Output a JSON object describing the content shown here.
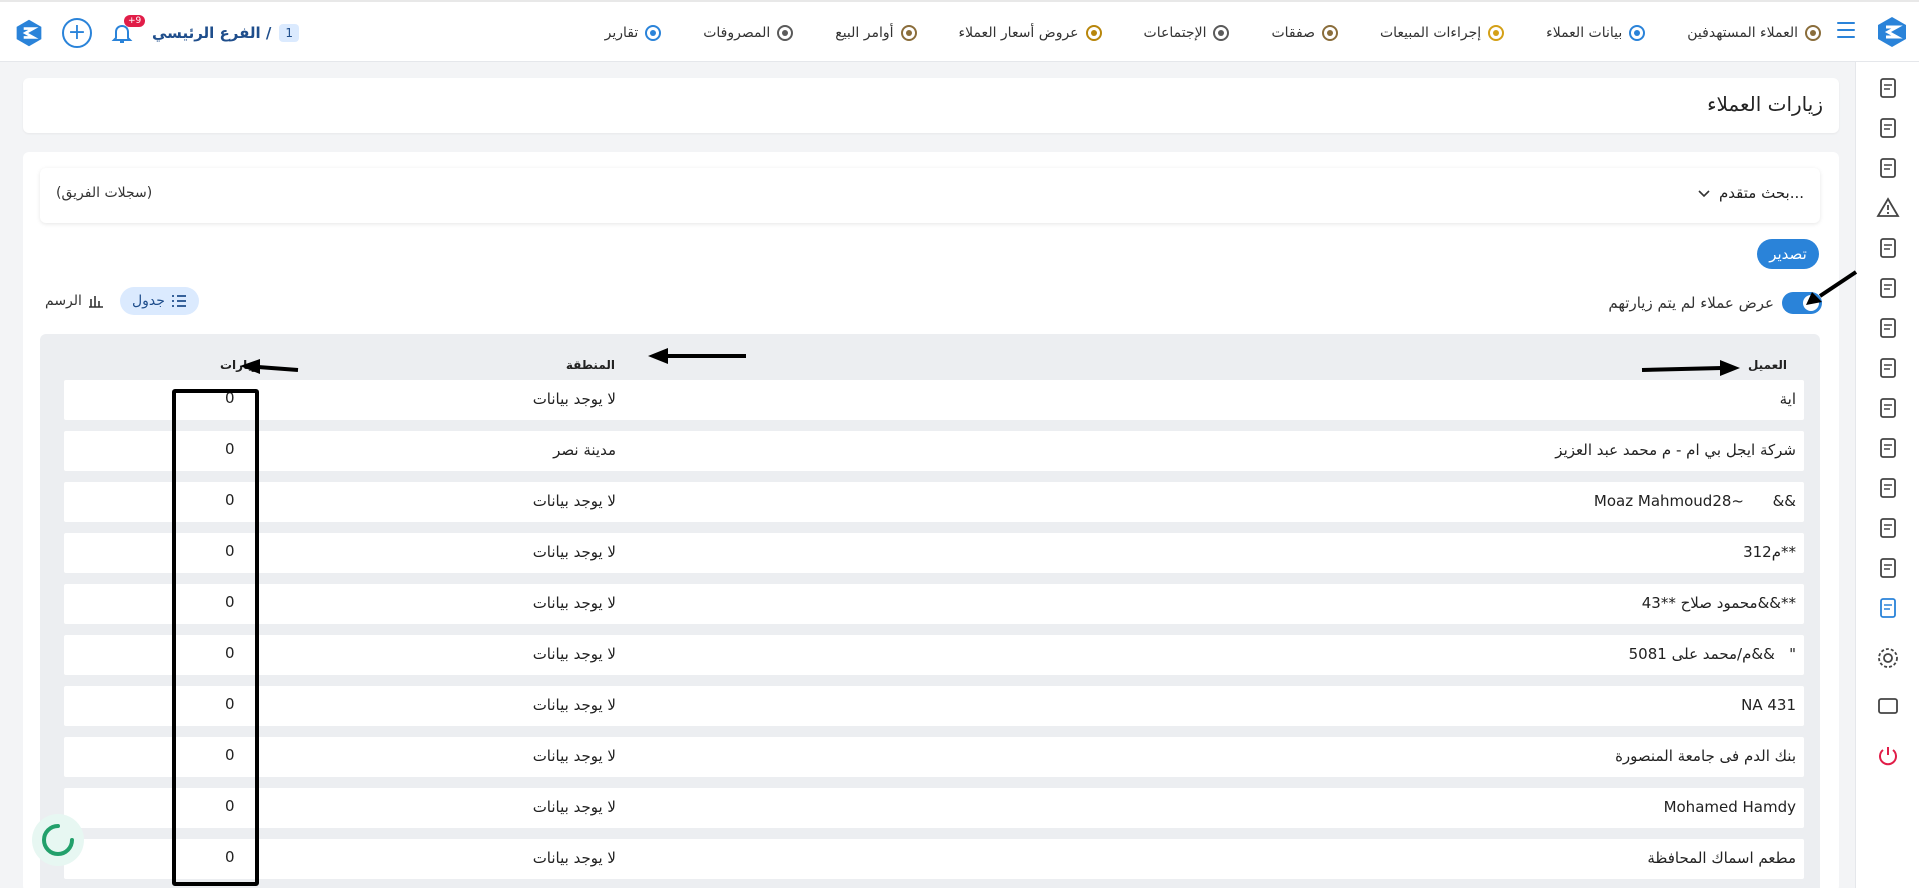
{
  "header": {
    "nav": [
      {
        "label": "العملاء المستهدفين",
        "icon": "target-users-icon"
      },
      {
        "label": "بيانات العملاء",
        "icon": "client-data-icon"
      },
      {
        "label": "إجراءات المبيعات",
        "icon": "sales-actions-icon"
      },
      {
        "label": "صفقات",
        "icon": "deals-icon"
      },
      {
        "label": "الإجتماعات",
        "icon": "meetings-icon"
      },
      {
        "label": "عروض أسعار العملاء",
        "icon": "quotes-icon"
      },
      {
        "label": "أوامر البيع",
        "icon": "sales-orders-icon"
      },
      {
        "label": "المصروفات",
        "icon": "expenses-icon"
      },
      {
        "label": "تقارير",
        "icon": "reports-icon"
      }
    ],
    "branch_label": "الفرع الرئيسي /",
    "branch_number": "1",
    "notifications_badge": "+9"
  },
  "page": {
    "title": "زيارات العملاء"
  },
  "filters": {
    "advanced_search": "بحث متقدم...",
    "team_records": "(سجلات الفريق)"
  },
  "actions": {
    "export": "تصدير",
    "toggle_label": "عرض عملاء لم يتم زيارتهم",
    "toggle_on": true,
    "view_table": "جدول",
    "view_chart": "الرسم"
  },
  "table": {
    "headers": {
      "client": "العميل",
      "area": "المنطقة",
      "visits": "زيارات"
    },
    "rows": [
      {
        "client": "اية",
        "area": "لا يوجد بيانات",
        "visits": "0"
      },
      {
        "client": "شركة ايجل بي ام - م محمد عبد العزيز",
        "area": "مدينة نصر",
        "visits": "0"
      },
      {
        "client": "Moaz Mahmoud28~      &&",
        "area": "لا يوجد بيانات",
        "visits": "0"
      },
      {
        "client": "م312**",
        "area": "لا يوجد بيانات",
        "visits": "0"
      },
      {
        "client": "محمود صلاح **43&&**",
        "area": "لا يوجد بيانات",
        "visits": "0"
      },
      {
        "client": "م/محمد على 5081&&   \"",
        "area": "لا يوجد بيانات",
        "visits": "0"
      },
      {
        "client": "NA 431",
        "area": "لا يوجد بيانات",
        "visits": "0"
      },
      {
        "client": "بنك الدم فى جامعة المنصورة",
        "area": "لا يوجد بيانات",
        "visits": "0"
      },
      {
        "client": "Mohamed Hamdy",
        "area": "لا يوجد بيانات",
        "visits": "0"
      },
      {
        "client": "مطعم اسماك المحافظة",
        "area": "لا يوجد بيانات",
        "visits": "0"
      }
    ]
  },
  "sidebar": {
    "icons": [
      "new-doc-icon",
      "team-icon",
      "money-icon",
      "warning-icon",
      "video-icon",
      "mountain-icon",
      "invoice-icon",
      "pen-icon",
      "truck-icon",
      "delivery-icon",
      "user-settings-icon",
      "add-doc-icon",
      "file-search-icon",
      "chart-icon",
      "gear-icon",
      "window-icon",
      "power-icon"
    ]
  },
  "colors": {
    "accent": "#2a83d9",
    "badge": "#e11d48"
  }
}
